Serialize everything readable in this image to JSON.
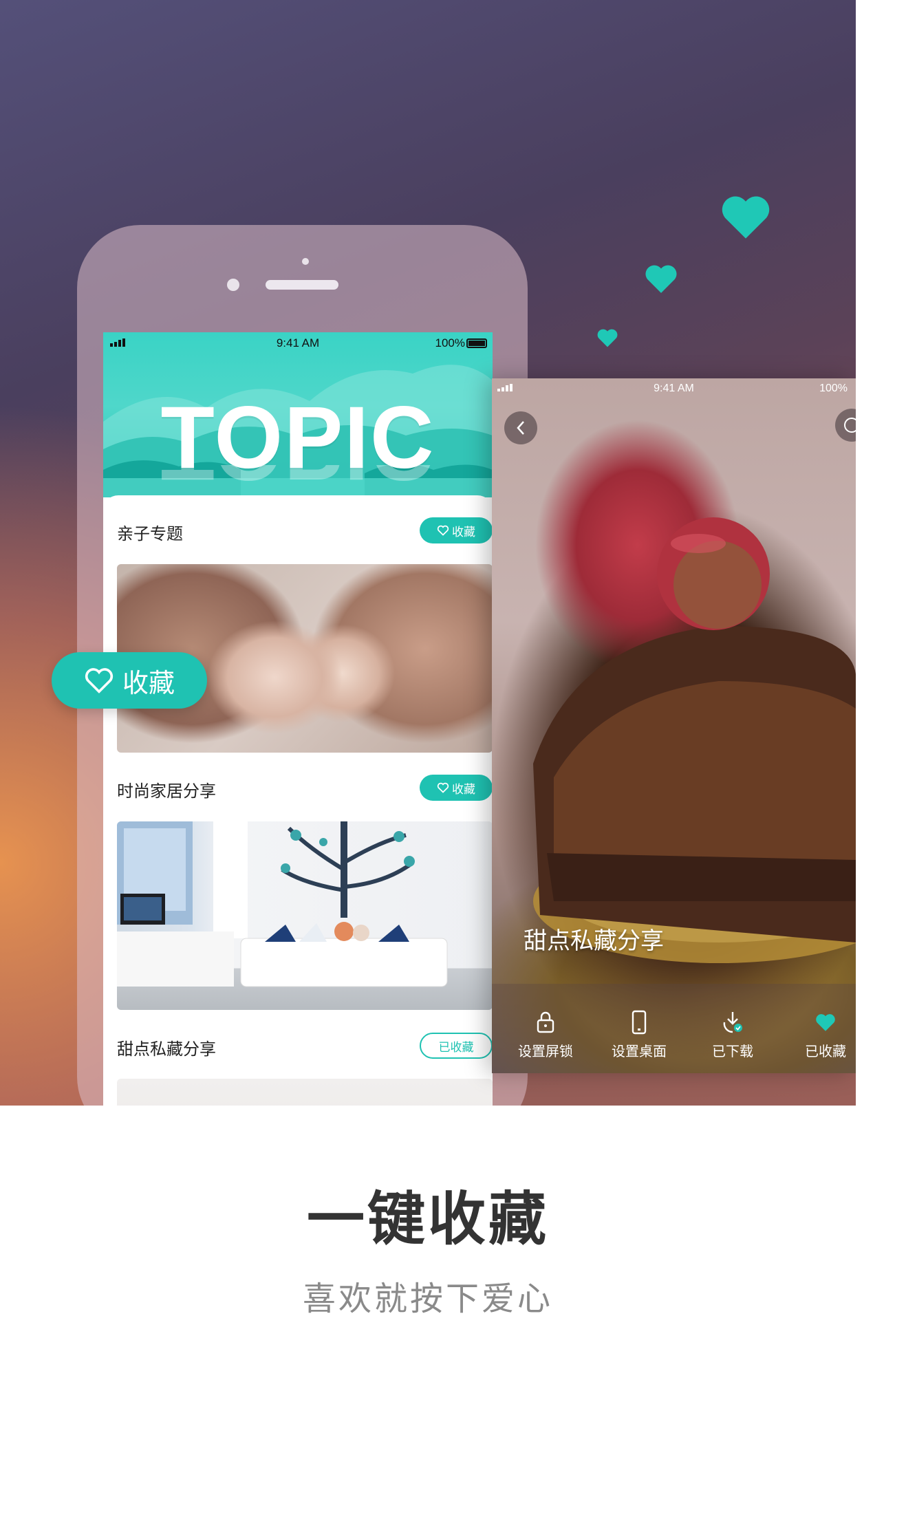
{
  "colors": {
    "accent": "#1fc2b2",
    "caption_title": "#333333",
    "caption_sub": "#8a8a8a"
  },
  "left_screen": {
    "status": {
      "time": "9:41 AM",
      "battery": "100%"
    },
    "banner_title": "TOPIC",
    "sections": [
      {
        "title": "亲子专题",
        "collect_label": "收藏",
        "collected": false,
        "icon": "heart-outline-icon"
      },
      {
        "title": "时尚家居分享",
        "collect_label": "收藏",
        "collected": false,
        "icon": "heart-outline-icon"
      },
      {
        "title": "甜点私藏分享",
        "collect_label": "已收藏",
        "collected": true
      }
    ]
  },
  "big_collect": {
    "label": "收藏",
    "icon": "heart-outline-icon"
  },
  "right_screen": {
    "status": {
      "time": "9:41 AM",
      "battery": "100%"
    },
    "title": "甜点私藏分享",
    "actions": [
      {
        "label": "设置屏锁",
        "icon": "lock-icon"
      },
      {
        "label": "设置桌面",
        "icon": "phone-icon"
      },
      {
        "label": "已下载",
        "icon": "download-check-icon"
      },
      {
        "label": "已收藏",
        "icon": "heart-filled-icon"
      }
    ]
  },
  "caption": {
    "title": "一键收藏",
    "subtitle": "喜欢就按下爱心"
  }
}
